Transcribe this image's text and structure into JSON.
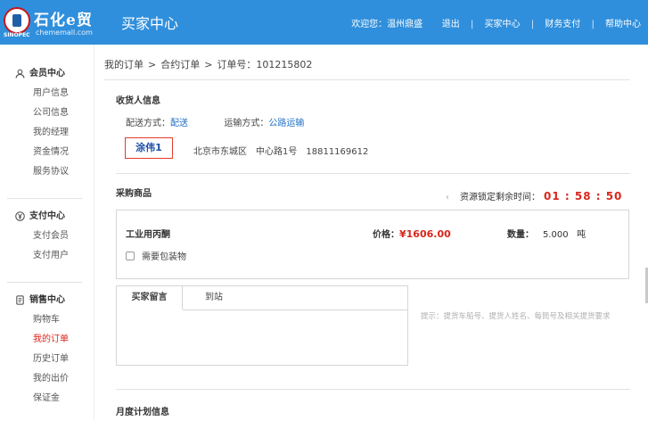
{
  "header": {
    "logo_text": "石化e贸",
    "logo_url": "chememall.com",
    "logo_brand": "SINOPEC",
    "title": "买家中心",
    "nav": {
      "welcome": "欢迎您：温州鼎盛",
      "logout": "退出",
      "buyer_center": "买家中心",
      "finance": "财务支付",
      "help": "帮助中心"
    }
  },
  "sidebar": {
    "member": {
      "title": "会员中心",
      "items": [
        "用户信息",
        "公司信息",
        "我的经理",
        "资金情况",
        "服务协议"
      ]
    },
    "payment": {
      "title": "支付中心",
      "items": [
        "支付会员",
        "支付用户"
      ]
    },
    "sales": {
      "title": "销售中心",
      "items": [
        "购物车",
        "我的订单",
        "历史订单",
        "我的出价",
        "保证金"
      ]
    }
  },
  "breadcrumb": {
    "items": [
      "我的订单",
      "合约订单",
      "订单号：101215802"
    ],
    "separator": ">"
  },
  "receiver": {
    "section_title": "收货人信息",
    "delivery_label": "配送方式：",
    "delivery_value": "配送",
    "transport_label": "运输方式：",
    "transport_value": "公路运输",
    "name": "涂伟1",
    "address": "北京市东城区",
    "street": "中心路1号",
    "phone": "18811169612"
  },
  "purchase": {
    "section_title": "采购商品",
    "countdown_label": "资源锁定剩余时间：",
    "countdown_value": "01 : 58 : 50",
    "product_name": "工业用丙酮",
    "price_label": "价格：",
    "price_value": "¥1606.00",
    "qty_label": "数量：",
    "qty_value": "5.000",
    "qty_unit": "吨",
    "packaging_label": "需要包装物"
  },
  "message": {
    "tab_buyer": "买家留言",
    "tab_station": "到站",
    "hint": "提示：提货车船号、提货人姓名、每筒号及相关提货要求"
  },
  "monthly": {
    "section_title": "月度计划信息"
  },
  "colors": {
    "header_bg": "#2f8fdc",
    "accent_red": "#d9261c",
    "link_blue": "#1f6fc5"
  }
}
